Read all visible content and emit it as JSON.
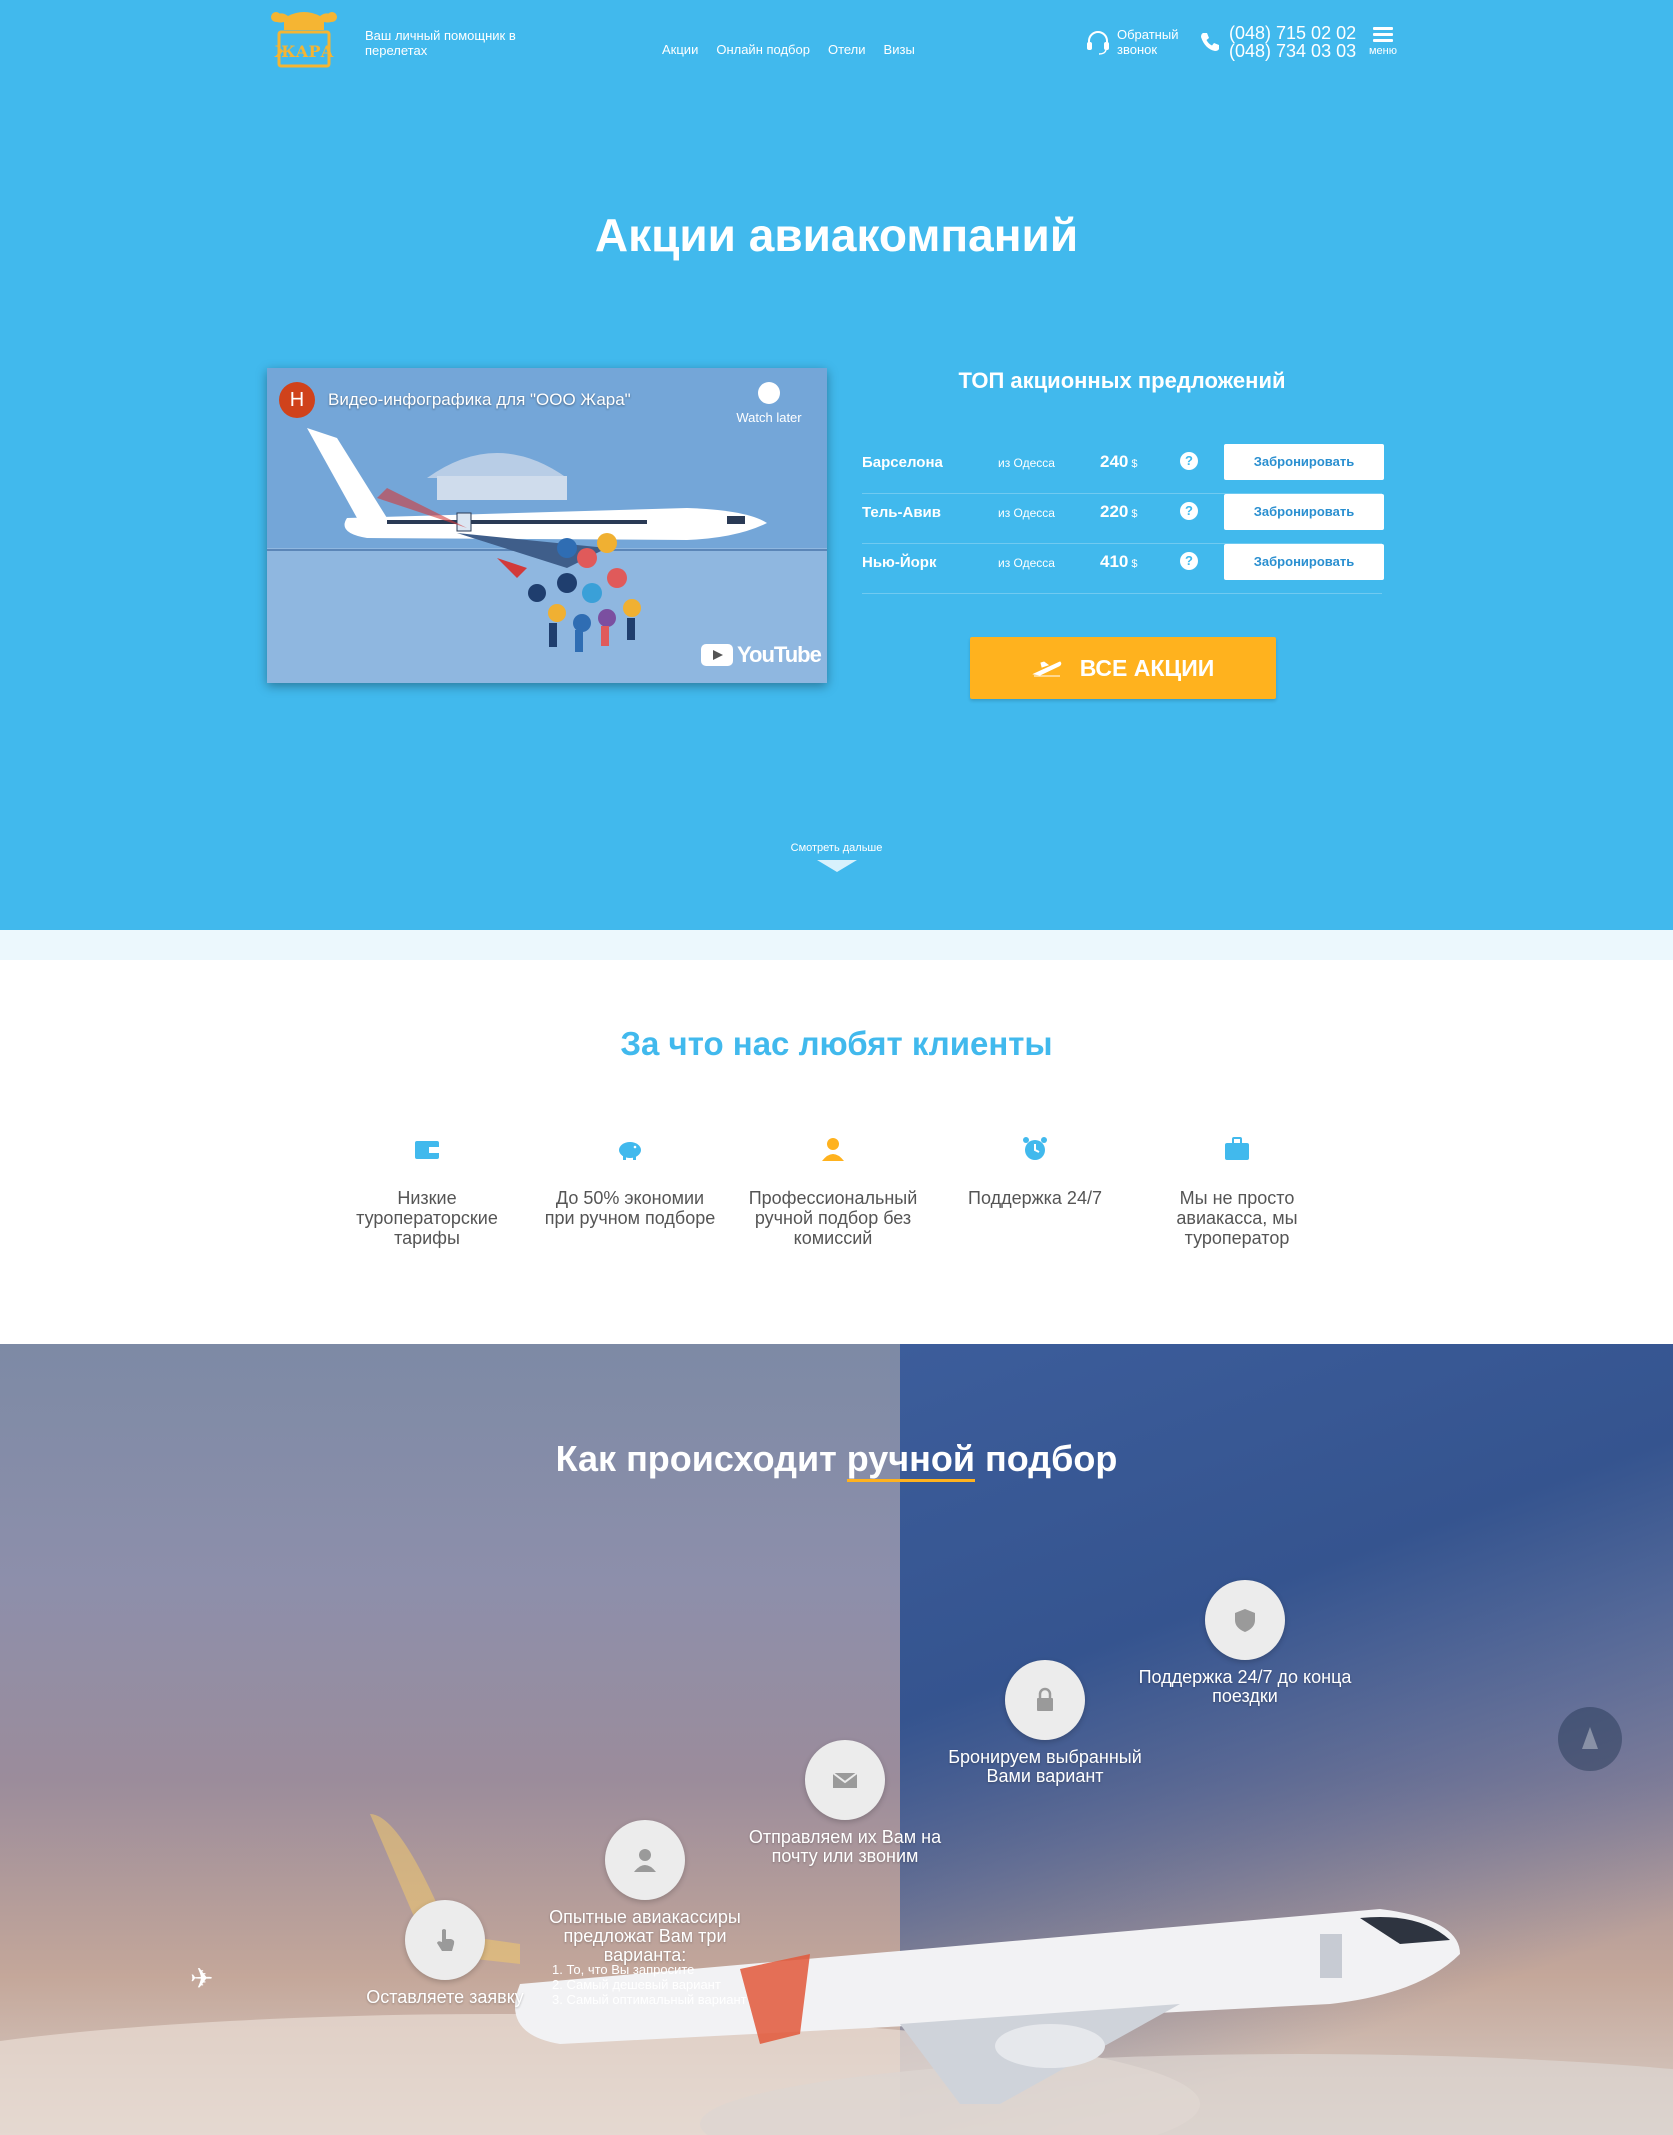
{
  "header": {
    "logo_text": "ЖАРА",
    "tagline": "Ваш личный помощник в перелетах",
    "nav": [
      "Акции",
      "Онлайн подбор",
      "Отели",
      "Визы"
    ],
    "callback": "Обратный звонок",
    "phone1": "(048) 715 02 02",
    "phone2": "(048) 734 03 03",
    "menu_label": "меню"
  },
  "hero": {
    "title": "Акции авиакомпаний",
    "video": {
      "avatar_letter": "H",
      "title": "Видео-инфографика для \"ООО Жара\"",
      "watch_later": "Watch later",
      "youtube": "YouTube"
    },
    "offers_title": "ТОП акционных предложений",
    "offers": [
      {
        "city": "Барселона",
        "from": "из Одесса",
        "price": "240",
        "currency": "$",
        "button": "Забронировать"
      },
      {
        "city": "Тель-Авив",
        "from": "из Одесса",
        "price": "220",
        "currency": "$",
        "button": "Забронировать"
      },
      {
        "city": "Нью-Йорк",
        "from": "из Одесса",
        "price": "410",
        "currency": "$",
        "button": "Забронировать"
      }
    ],
    "all_deals": "ВСЕ АКЦИИ",
    "see_more": "Смотреть дальше"
  },
  "features": {
    "title": "За что нас любят клиенты",
    "items": [
      {
        "icon": "wallet-icon",
        "text": "Низкие туроператорские тарифы"
      },
      {
        "icon": "piggy-bank-icon",
        "text": "До 50% экономии при ручном подборе"
      },
      {
        "icon": "person-icon",
        "text": "Профессиональный ручной подбор без комиссий"
      },
      {
        "icon": "alarm-clock-icon",
        "text": "Поддержка 24/7"
      },
      {
        "icon": "suitcase-icon",
        "text": "Мы не просто авиакасса, мы туроператор"
      }
    ]
  },
  "process": {
    "title_before": "Как происходит ",
    "title_underlined": "ручной",
    "title_after": " подбор",
    "steps": [
      {
        "icon": "hand-pointer-icon",
        "label": "Оставляете заявку"
      },
      {
        "icon": "user-icon",
        "label": "Опытные авиакассиры предложат Вам три варианта:"
      },
      {
        "icon": "envelope-icon",
        "label": "Отправляем их Вам на почту или звоним"
      },
      {
        "icon": "lock-icon",
        "label": "Бронируем выбранный Вами вариант"
      },
      {
        "icon": "shield-icon",
        "label": "Поддержка 24/7 до конца поездки"
      }
    ],
    "options": [
      "1. То, что Вы запросите",
      "2. Самый дешевый вариант",
      "3. Самый оптимальный вариант"
    ]
  },
  "colors": {
    "hero_blue": "#41b9ed",
    "accent_orange": "#ffb21e",
    "button_text_blue": "#2a8fd0",
    "logo_gold": "#f5b533"
  }
}
